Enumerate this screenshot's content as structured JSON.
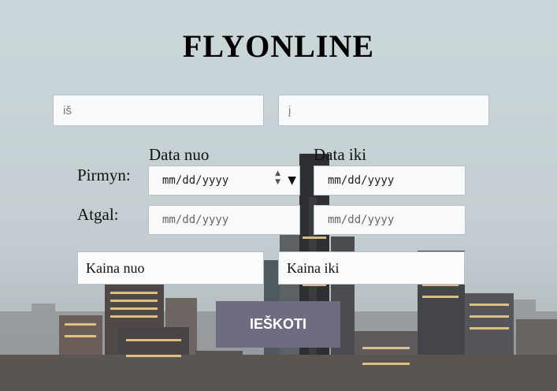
{
  "app": {
    "title": "FLYONLINE"
  },
  "search": {
    "from_placeholder": "iš",
    "to_placeholder": "į"
  },
  "dates": {
    "from_header": "Data nuo",
    "to_header": "Data iki",
    "outbound_label": "Pirmyn:",
    "return_label": "Atgal:",
    "outbound_from": "mm/dd/yyyy",
    "outbound_to": "mm/dd/yyyy",
    "return_from": "mm/dd/yyyy",
    "return_to": "mm/dd/yyyy"
  },
  "price": {
    "min": "Kaina nuo",
    "max": "Kaina iki"
  },
  "actions": {
    "search_label": "IEŠKOTI"
  },
  "colors": {
    "button": "#6e6c80",
    "field_border": "#b9bfc4"
  },
  "icons": {
    "spinner": "spinner-icon",
    "dropdown": "dropdown-arrow-icon"
  }
}
